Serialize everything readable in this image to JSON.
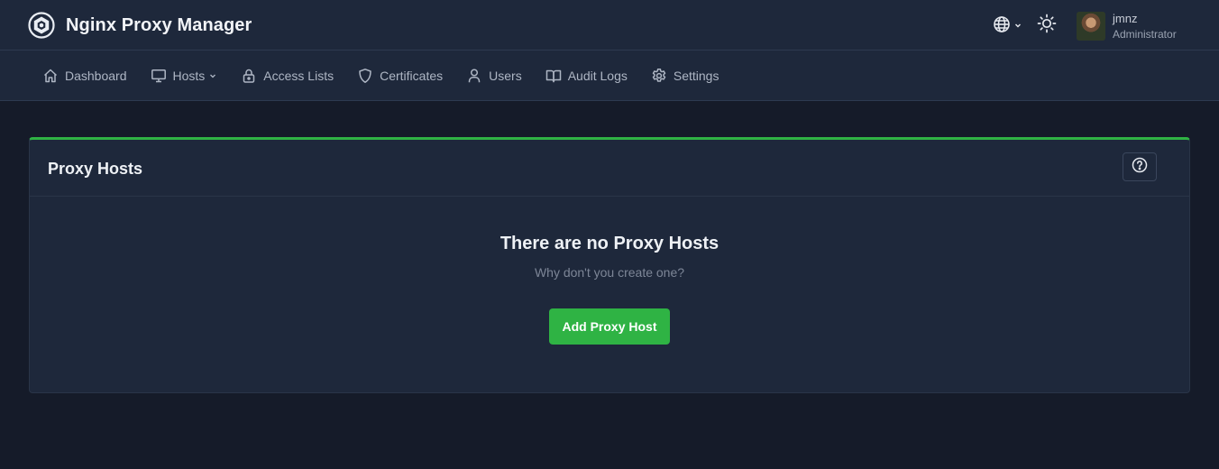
{
  "app": {
    "title": "Nginx Proxy Manager",
    "logo_icon": "npm-hexagon-logo-icon"
  },
  "header": {
    "language_icon": "globe-icon",
    "theme_icon": "sun-icon",
    "user": {
      "name": "jmnz",
      "role": "Administrator"
    }
  },
  "nav": {
    "items": [
      {
        "label": "Dashboard",
        "icon": "home-icon"
      },
      {
        "label": "Hosts",
        "icon": "monitor-icon",
        "has_dropdown": true
      },
      {
        "label": "Access Lists",
        "icon": "lock-icon"
      },
      {
        "label": "Certificates",
        "icon": "shield-icon"
      },
      {
        "label": "Users",
        "icon": "user-icon"
      },
      {
        "label": "Audit Logs",
        "icon": "book-icon"
      },
      {
        "label": "Settings",
        "icon": "gear-icon"
      }
    ]
  },
  "card": {
    "title": "Proxy Hosts",
    "help_icon": "question-circle-icon",
    "empty_title": "There are no Proxy Hosts",
    "empty_subtitle": "Why don't you create one?",
    "add_button_label": "Add Proxy Host"
  },
  "colors": {
    "accent": "#2fb344",
    "background": "#151b29",
    "surface": "#1e283b"
  }
}
